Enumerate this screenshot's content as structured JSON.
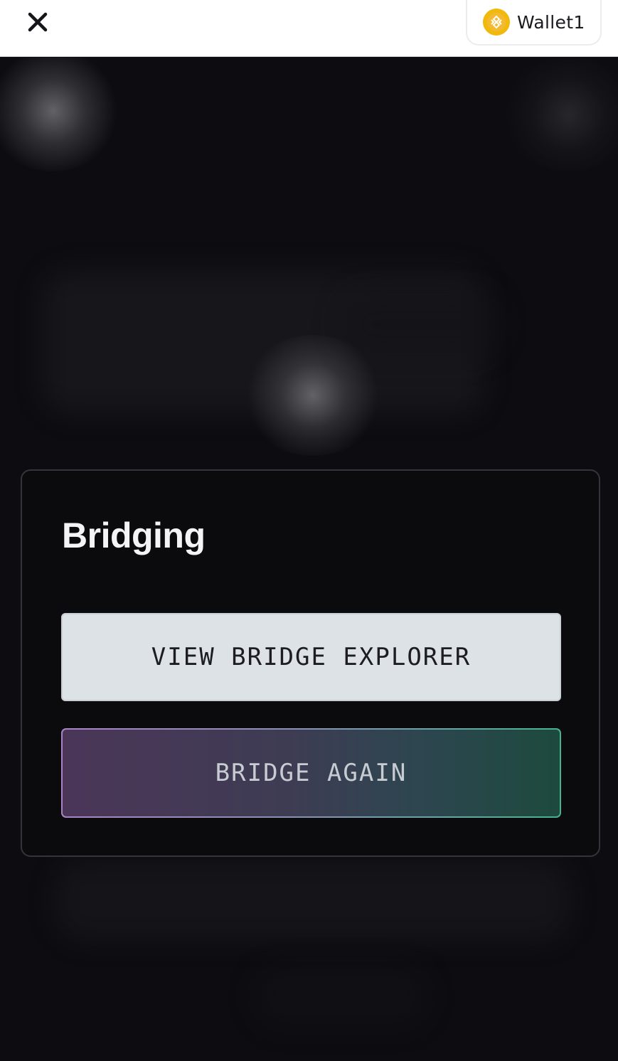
{
  "header": {
    "close_icon": "close-icon",
    "wallet": {
      "icon": "bnb-coin-icon",
      "label": "Wallet1",
      "icon_color": "#f0b90b"
    }
  },
  "dialog": {
    "title": "Bridging",
    "buttons": {
      "explorer_label": "VIEW BRIDGE EXPLORER",
      "again_label": "BRIDGE AGAIN"
    }
  },
  "colors": {
    "background": "#0d0d11",
    "card_background": "#0b0b0e",
    "explorer_button": "#dde2e6",
    "again_gradient_start": "#4b3658",
    "again_gradient_end": "#1d4a3d"
  }
}
